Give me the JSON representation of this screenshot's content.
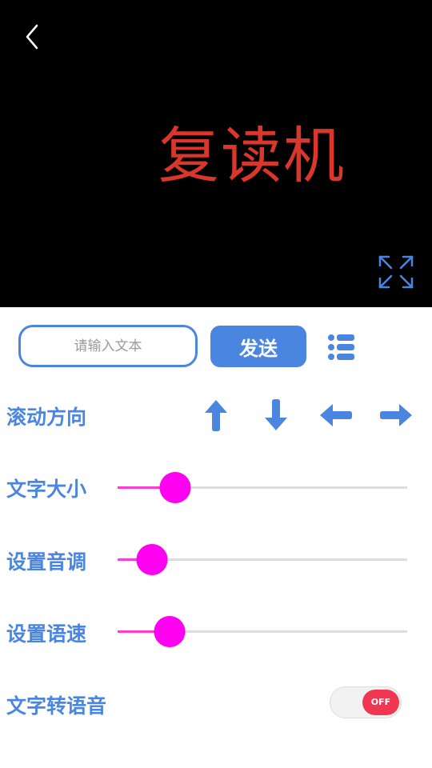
{
  "display": {
    "text": "复读机",
    "text_color": "#d9372b",
    "background": "#000000"
  },
  "icons": {
    "back": "chevron-left-icon",
    "fullscreen": "expand-icon",
    "list": "list-icon",
    "up": "arrow-up-icon",
    "down": "arrow-down-icon",
    "left": "arrow-left-icon",
    "right": "arrow-right-icon"
  },
  "input": {
    "placeholder": "请输入文本",
    "value": ""
  },
  "send_label": "发送",
  "scroll": {
    "label": "滚动方向"
  },
  "sliders": {
    "text_size": {
      "label": "文字大小",
      "value": 0.2
    },
    "pitch": {
      "label": "设置音调",
      "value": 0.12
    },
    "speed": {
      "label": "设置语速",
      "value": 0.18
    }
  },
  "tts": {
    "label": "文字转语音",
    "state": "OFF"
  },
  "colors": {
    "accent": "#4a86e0",
    "slider_thumb": "#ff00f0",
    "toggle_off": "#f03650"
  }
}
